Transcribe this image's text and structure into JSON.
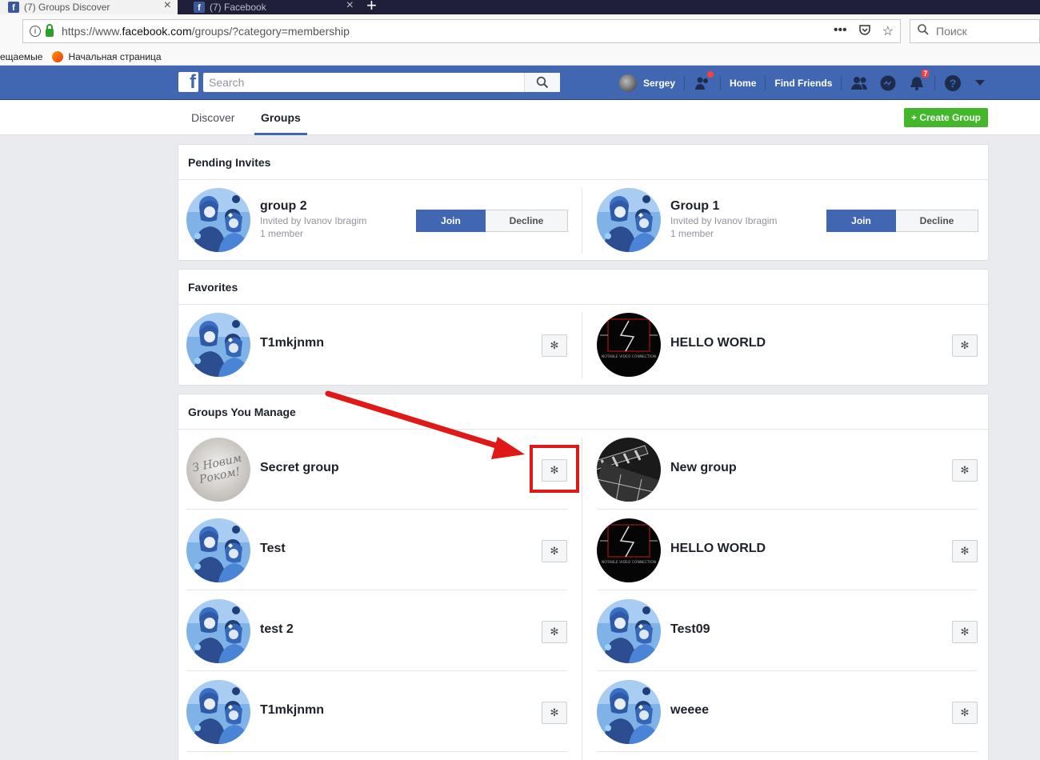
{
  "browser": {
    "tabs": [
      {
        "label": "(7) Groups Discover",
        "favicon": "facebook-icon"
      },
      {
        "label": "(7) Facebook",
        "favicon": "facebook-icon"
      }
    ],
    "url_prefix": "https://www.",
    "url_domain": "facebook.com",
    "url_suffix": "/groups/?category=membership",
    "search_placeholder": "Поиск",
    "bookmarks": [
      "ещаемые",
      "Начальная страница"
    ]
  },
  "fb": {
    "search_placeholder": "Search",
    "user": "Sergey",
    "nav_home": "Home",
    "nav_find_friends": "Find Friends",
    "notifications_count": "7"
  },
  "subnav": {
    "tabs": [
      "Discover",
      "Groups"
    ],
    "active_tab": "Groups",
    "create_button": "+ Create Group"
  },
  "pending": {
    "title": "Pending Invites",
    "join_label": "Join",
    "decline_label": "Decline",
    "items": [
      {
        "name": "group 2",
        "invited_by": "Invited by Ivanov Ibragim",
        "members": "1 member"
      },
      {
        "name": "Group 1",
        "invited_by": "Invited by Ivanov Ibragim",
        "members": "1 member"
      }
    ]
  },
  "favorites": {
    "title": "Favorites",
    "items": [
      {
        "name": "T1mkjnmn",
        "image": "illustration"
      },
      {
        "name": "HELLO WORLD",
        "image": "dark-logo"
      }
    ]
  },
  "manage": {
    "title": "Groups You Manage",
    "items": [
      {
        "name": "Secret group",
        "image": "card"
      },
      {
        "name": "New group",
        "image": "clapper"
      },
      {
        "name": "Test",
        "image": "illustration"
      },
      {
        "name": "HELLO WORLD",
        "image": "dark-logo"
      },
      {
        "name": "test 2",
        "image": "illustration"
      },
      {
        "name": "Test09",
        "image": "illustration"
      },
      {
        "name": "T1mkjnmn",
        "image": "illustration"
      },
      {
        "name": "weeee",
        "image": "illustration"
      }
    ]
  },
  "secret_image_text": "З Новим Роком!",
  "dark_logo_text": "NOTABLE VIDEO CONNECTION",
  "colors": {
    "fb_blue": "#4267b2",
    "create_green": "#42b72a",
    "highlight_red": "#e01818"
  }
}
